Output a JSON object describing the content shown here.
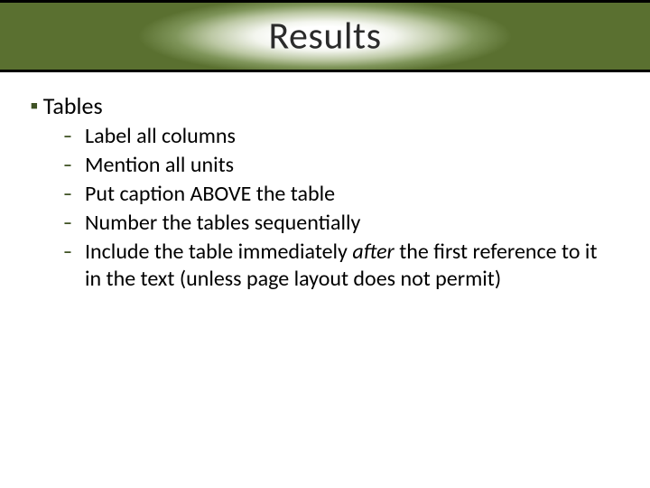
{
  "title": "Results",
  "section": {
    "heading": "Tables",
    "items": [
      "Label all columns",
      "Mention all units",
      "Put caption ABOVE the table",
      "Number the tables sequentially"
    ],
    "last_item": {
      "prefix": "Include the table immediately ",
      "emph": "after",
      "suffix": " the first reference to it in the text (unless page layout does not permit)"
    }
  },
  "colors": {
    "accent": "#5a7030",
    "bullet": "#3f5224"
  }
}
